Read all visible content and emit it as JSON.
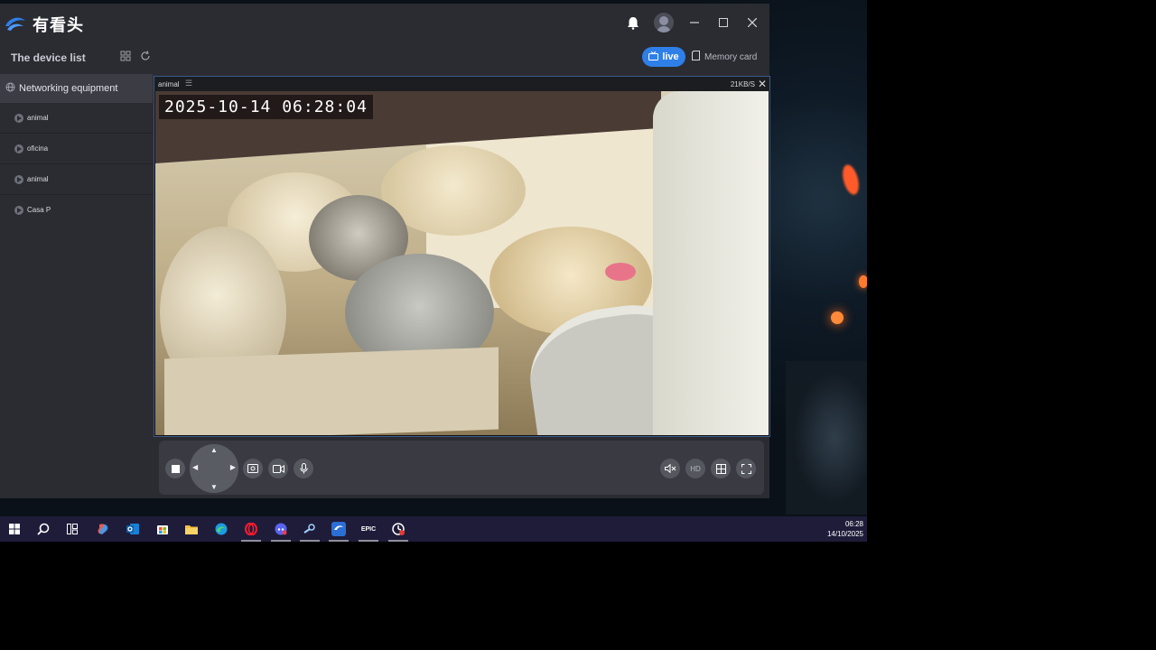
{
  "app": {
    "logo_text": "有看头",
    "titlebar": {
      "notification_icon": "bell-icon",
      "avatar_icon": "user-avatar-icon"
    },
    "subbar": {
      "device_list_title": "The device list",
      "grid_icon": "grid-view-icon",
      "refresh_icon": "refresh-icon",
      "live_label": "live",
      "memory_card_label": "Memory card"
    }
  },
  "sidebar": {
    "group_label": "Networking equipment",
    "items": [
      {
        "label": "animal"
      },
      {
        "label": "oficina"
      },
      {
        "label": "animal"
      },
      {
        "label": "Casa P"
      }
    ]
  },
  "video": {
    "camera_name": "animal",
    "bitrate": "21KB/S",
    "timestamp": "2025-10-14  06:28:04"
  },
  "controls": {
    "stop_icon": "stop-icon",
    "ptz_icon": "ptz-direction-icon",
    "screenshot_icon": "screenshot-icon",
    "record_icon": "record-icon",
    "mic_icon": "microphone-icon",
    "mute_icon": "mute-icon",
    "hd_label": "HD",
    "split_icon": "split-screen-icon",
    "fullscreen_icon": "fullscreen-icon"
  },
  "taskbar": {
    "time": "06:28",
    "date": "14/10/2025"
  }
}
